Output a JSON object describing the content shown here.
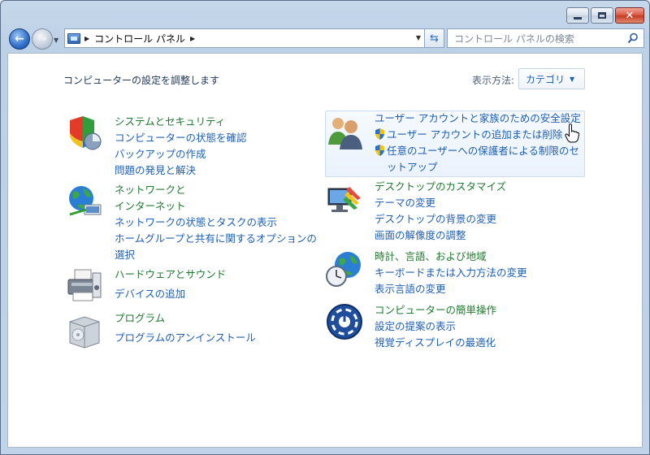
{
  "nav": {
    "breadcrumb": "コントロール パネル",
    "search_placeholder": "コントロール パネルの検索"
  },
  "header": {
    "subtitle": "コンピューターの設定を調整します",
    "viewby_label": "表示方法:",
    "viewby_value": "カテゴリ"
  },
  "categories": [
    {
      "title": "システムとセキュリティ",
      "links": [
        "コンピューターの状態を確認",
        "バックアップの作成",
        "問題の発見と解決"
      ]
    },
    {
      "title": "ネットワークと",
      "title2": "インターネット",
      "links": [
        "ネットワークの状態とタスクの表示",
        "ホームグループと共有に関するオプションの",
        "選択"
      ]
    },
    {
      "title": "ハードウェアとサウンド",
      "links": [
        "デバイスの追加"
      ]
    },
    {
      "title": "プログラム",
      "links": [
        "プログラムのアンインストール"
      ]
    },
    {
      "title": "ユーザー アカウントと家族のための安全設定",
      "links": [
        "ユーザー アカウントの追加または削除",
        "任意のユーザーへの保護者による制限のセ",
        "ットアップ"
      ]
    },
    {
      "title": "デスクトップのカスタマイズ",
      "links": [
        "テーマの変更",
        "デスクトップの背景の変更",
        "画面の解像度の調整"
      ]
    },
    {
      "title": "時計、言語、および地域",
      "links": [
        "キーボードまたは入力方法の変更",
        "表示言語の変更"
      ]
    },
    {
      "title": "コンピューターの簡単操作",
      "links": [
        "設定の提案の表示",
        "視覚ディスプレイの最適化"
      ]
    }
  ],
  "colors": {
    "category_title": "#1f7a2f",
    "link": "#1e5fb0"
  }
}
